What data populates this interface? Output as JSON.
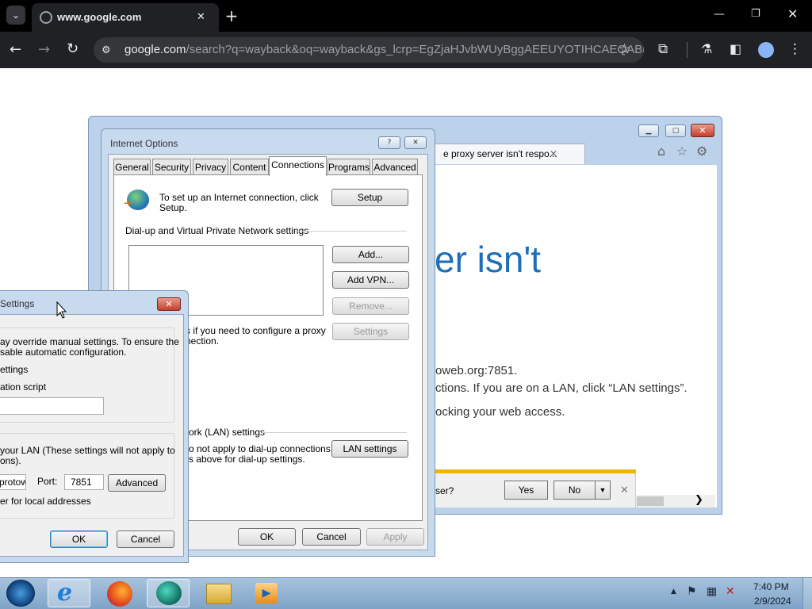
{
  "browser": {
    "tab_title": "www.google.com",
    "tab_close": "✕",
    "new_tab": "+",
    "url_domain": "google.com",
    "url_path": "/search?q=wayback&oq=wayback&gs_lcrp=EgZjaHJvbWUyBggAEEUYOTIHCAEQABiP..."
  },
  "ie": {
    "tab_title": "e proxy server isn't respo...",
    "heading_fragment": "er isn't",
    "line1": "oweb.org:7851.",
    "line2": "ctions. If you are on a LAN, click “LAN settings”.",
    "line3": "ocking your web access.",
    "notify_text": "ser?",
    "notify_yes": "Yes",
    "notify_no": "No"
  },
  "internet_options": {
    "title": "Internet Options",
    "help": "?",
    "tabs": [
      "General",
      "Security",
      "Privacy",
      "Content",
      "Connections",
      "Programs",
      "Advanced"
    ],
    "setup_text": "To set up an Internet connection, click Setup.",
    "setup_button": "Setup",
    "dialup_heading": "Dial-up and Virtual Private Network settings",
    "add_button": "Add...",
    "add_vpn_button": "Add VPN...",
    "remove_button": "Remove...",
    "settings_button": "Settings",
    "proxy_text_1": "s if you need to configure a proxy",
    "proxy_text_2": "nection.",
    "lan_heading": "ork (LAN) settings",
    "lan_text_1": "o not apply to dial-up connections.",
    "lan_text_2": "s above for dial-up settings.",
    "lan_settings_button": "LAN settings",
    "ok": "OK",
    "cancel": "Cancel",
    "apply": "Apply"
  },
  "lan_dialog": {
    "title": "Settings",
    "auto_text_1": "ay override manual settings.  To ensure the",
    "auto_text_2": "sable automatic configuration.",
    "auto_detect": "ettings",
    "auto_script": "ation script",
    "proxy_text_1": "your LAN (These settings will not apply to",
    "proxy_text_2": "ons).",
    "address_value": "protow",
    "port_label": "Port:",
    "port_value": "7851",
    "advanced_button": "Advanced",
    "bypass_text": "er for local addresses",
    "ok": "OK",
    "cancel": "Cancel"
  },
  "taskbar": {
    "time": "7:40 PM",
    "date": "2/9/2024"
  }
}
